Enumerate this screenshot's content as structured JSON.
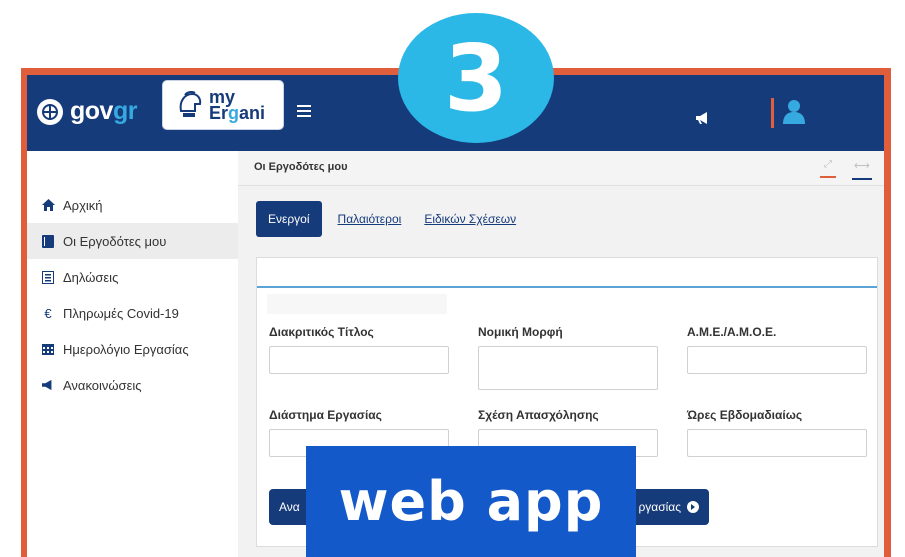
{
  "badge_number": "3",
  "caption": "web app",
  "header": {
    "gov_part1": "gov",
    "gov_part2": "gr",
    "logo_my": "my",
    "logo_name_part1": "Er",
    "logo_name_part2": "g",
    "logo_name_part3": "ani",
    "icons": [
      "hamburger-icon",
      "megaphone-icon",
      "user-icon"
    ]
  },
  "sidebar": {
    "items": [
      {
        "label": "Αρχική",
        "icon": "home-icon",
        "active": false
      },
      {
        "label": "Οι Εργοδότες μου",
        "icon": "book-icon",
        "active": true
      },
      {
        "label": "Δηλώσεις",
        "icon": "list-icon",
        "active": false
      },
      {
        "label": "Πληρωμές Covid-19",
        "icon": "euro-icon",
        "active": false
      },
      {
        "label": "Ημερολόγιο Εργασίας",
        "icon": "calendar-icon",
        "active": false
      },
      {
        "label": "Ανακοινώσεις",
        "icon": "megaphone-icon",
        "active": false
      }
    ]
  },
  "content": {
    "title": "Οι Εργοδότες μου",
    "tabs": [
      "Ενεργοί",
      "Παλαιότεροι",
      "Ειδικών Σχέσεων"
    ],
    "fields": [
      {
        "label": "Διακριτικός Τίτλος",
        "value": ""
      },
      {
        "label": "Νομική Μορφή",
        "value": ""
      },
      {
        "label": "Α.Μ.Ε./Α.Μ.Ο.Ε.",
        "value": ""
      },
      {
        "label": "Διάστημα Εργασίας",
        "value": ""
      },
      {
        "label": "Σχέση Απασχόλησης",
        "value": ""
      },
      {
        "label": "Ώρες Εβδομαδιαίως",
        "value": ""
      }
    ],
    "search_button_partial": "Ανα",
    "details_button_partial": "ργασίας"
  },
  "colors": {
    "navy": "#163b7a",
    "frame": "#e15e3c",
    "badge": "#2cb8e6",
    "caption_bg": "#1459c9"
  }
}
